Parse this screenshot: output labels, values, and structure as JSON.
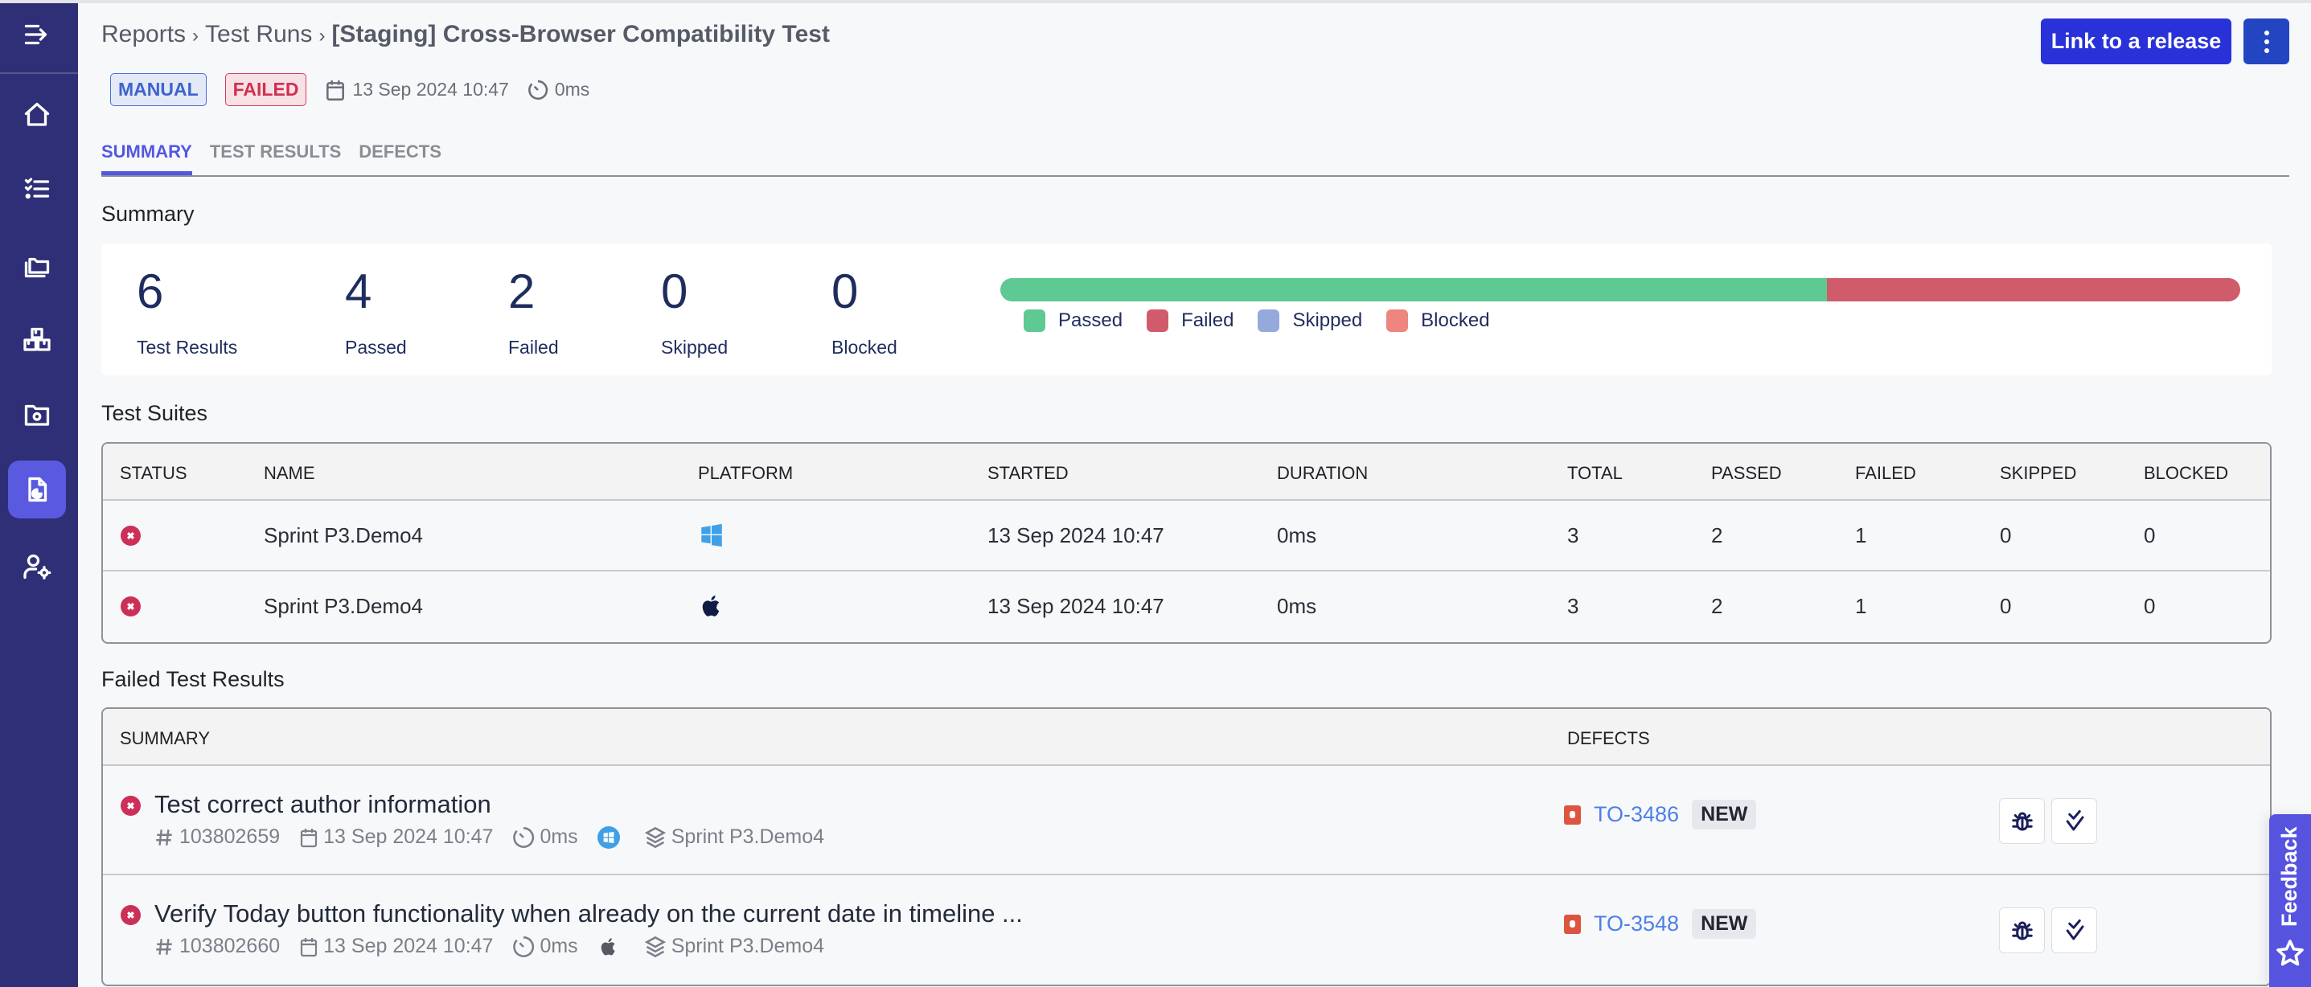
{
  "sidebar": {
    "items": [
      {
        "name": "collapse-menu",
        "icon": "menu-arrow-icon"
      },
      {
        "name": "home",
        "icon": "home-icon"
      },
      {
        "name": "test-cases",
        "icon": "checklist-icon"
      },
      {
        "name": "projects",
        "icon": "folders-icon"
      },
      {
        "name": "integrations",
        "icon": "boxes-icon"
      },
      {
        "name": "test-settings",
        "icon": "folder-gear-icon"
      },
      {
        "name": "reports",
        "icon": "report-icon",
        "active": true
      },
      {
        "name": "user-settings",
        "icon": "user-gear-icon"
      }
    ]
  },
  "header": {
    "breadcrumb": [
      "Reports",
      "Test Runs",
      "[Staging] Cross-Browser Compatibility Test"
    ],
    "separator": "›",
    "link_release_label": "Link to a release",
    "more_icon": "kebab-icon",
    "badges": {
      "type": "MANUAL",
      "status": "FAILED"
    },
    "date": "13 Sep 2024 10:47",
    "duration": "0ms"
  },
  "tabs": [
    {
      "label": "SUMMARY",
      "active": true
    },
    {
      "label": "TEST RESULTS",
      "active": false
    },
    {
      "label": "DEFECTS",
      "active": false
    }
  ],
  "summary": {
    "title": "Summary",
    "stats": [
      {
        "value": "6",
        "label": "Test Results"
      },
      {
        "value": "4",
        "label": "Passed"
      },
      {
        "value": "2",
        "label": "Failed"
      },
      {
        "value": "0",
        "label": "Skipped"
      },
      {
        "value": "0",
        "label": "Blocked"
      }
    ],
    "progress": [
      {
        "label": "Passed",
        "count": 4,
        "color": "#5ec993"
      },
      {
        "label": "Failed",
        "count": 2,
        "color": "#d05b6b"
      },
      {
        "label": "Skipped",
        "count": 0,
        "color": "#94aadc"
      },
      {
        "label": "Blocked",
        "count": 0,
        "color": "#ee857e"
      }
    ]
  },
  "suites": {
    "title": "Test Suites",
    "columns": [
      "STATUS",
      "NAME",
      "PLATFORM",
      "STARTED",
      "DURATION",
      "TOTAL",
      "PASSED",
      "FAILED",
      "SKIPPED",
      "BLOCKED"
    ],
    "rows": [
      {
        "status": "failed",
        "name": "Sprint P3.Demo4",
        "platform": "windows",
        "started": "13 Sep 2024 10:47",
        "duration": "0ms",
        "total": "3",
        "passed": "2",
        "failed": "1",
        "skipped": "0",
        "blocked": "0"
      },
      {
        "status": "failed",
        "name": "Sprint P3.Demo4",
        "platform": "apple",
        "started": "13 Sep 2024 10:47",
        "duration": "0ms",
        "total": "3",
        "passed": "2",
        "failed": "1",
        "skipped": "0",
        "blocked": "0"
      }
    ]
  },
  "failed_results": {
    "title": "Failed Test Results",
    "columns": [
      "SUMMARY",
      "DEFECTS"
    ],
    "rows": [
      {
        "status": "failed",
        "title": "Test correct author information",
        "id": "103802659",
        "date": "13 Sep 2024 10:47",
        "duration": "0ms",
        "platform": "windows",
        "suite": "Sprint P3.Demo4",
        "defect": "TO-3486",
        "defect_status": "NEW"
      },
      {
        "status": "failed",
        "title": "Verify Today button functionality when already on the current date in timeline ...",
        "id": "103802660",
        "date": "13 Sep 2024 10:47",
        "duration": "0ms",
        "platform": "apple",
        "suite": "Sprint P3.Demo4",
        "defect": "TO-3548",
        "defect_status": "NEW"
      }
    ]
  },
  "feedback": {
    "label": "Feedback"
  }
}
